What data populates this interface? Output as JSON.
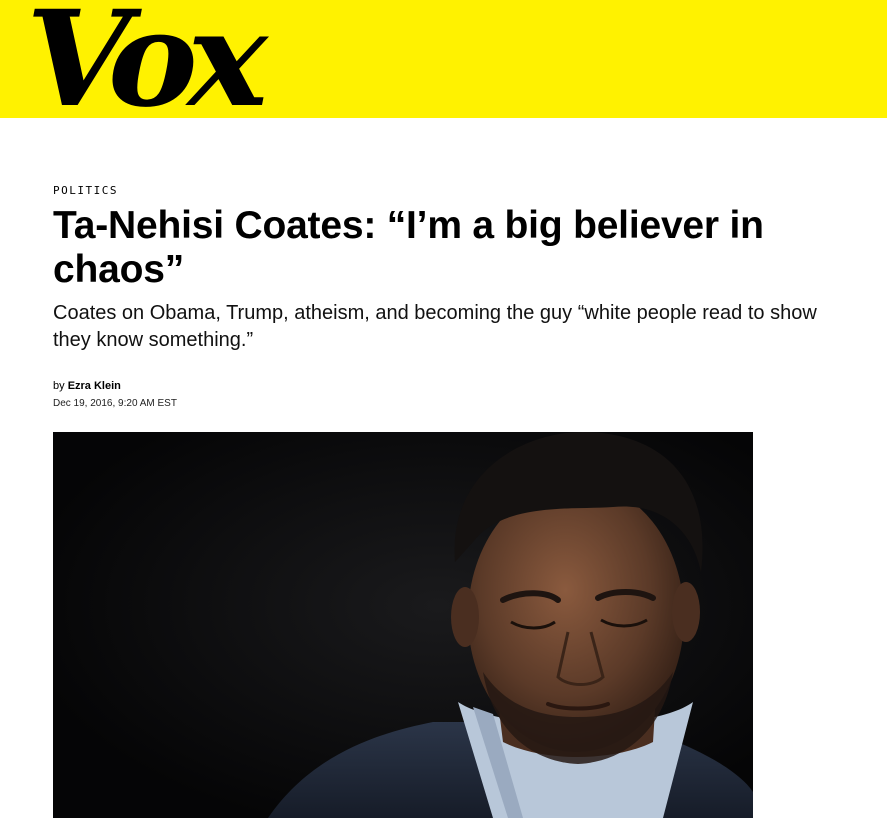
{
  "header": {
    "logo_text": "Vox",
    "band_color": "#FFF200"
  },
  "article": {
    "section": "POLITICS",
    "headline": "Ta-Nehisi Coates: “I’m a big believer in chaos”",
    "dek": "Coates on Obama, Trump, atheism, and becoming the guy “white people read to show they know something.”",
    "byline_prefix": "by",
    "author": "Ezra Klein",
    "timestamp": "Dec 19, 2016, 9:20 AM EST"
  },
  "hero_image": {
    "subject": "portrait-of-man-with-eyes-closed",
    "background_color": "#0a0a0b"
  }
}
